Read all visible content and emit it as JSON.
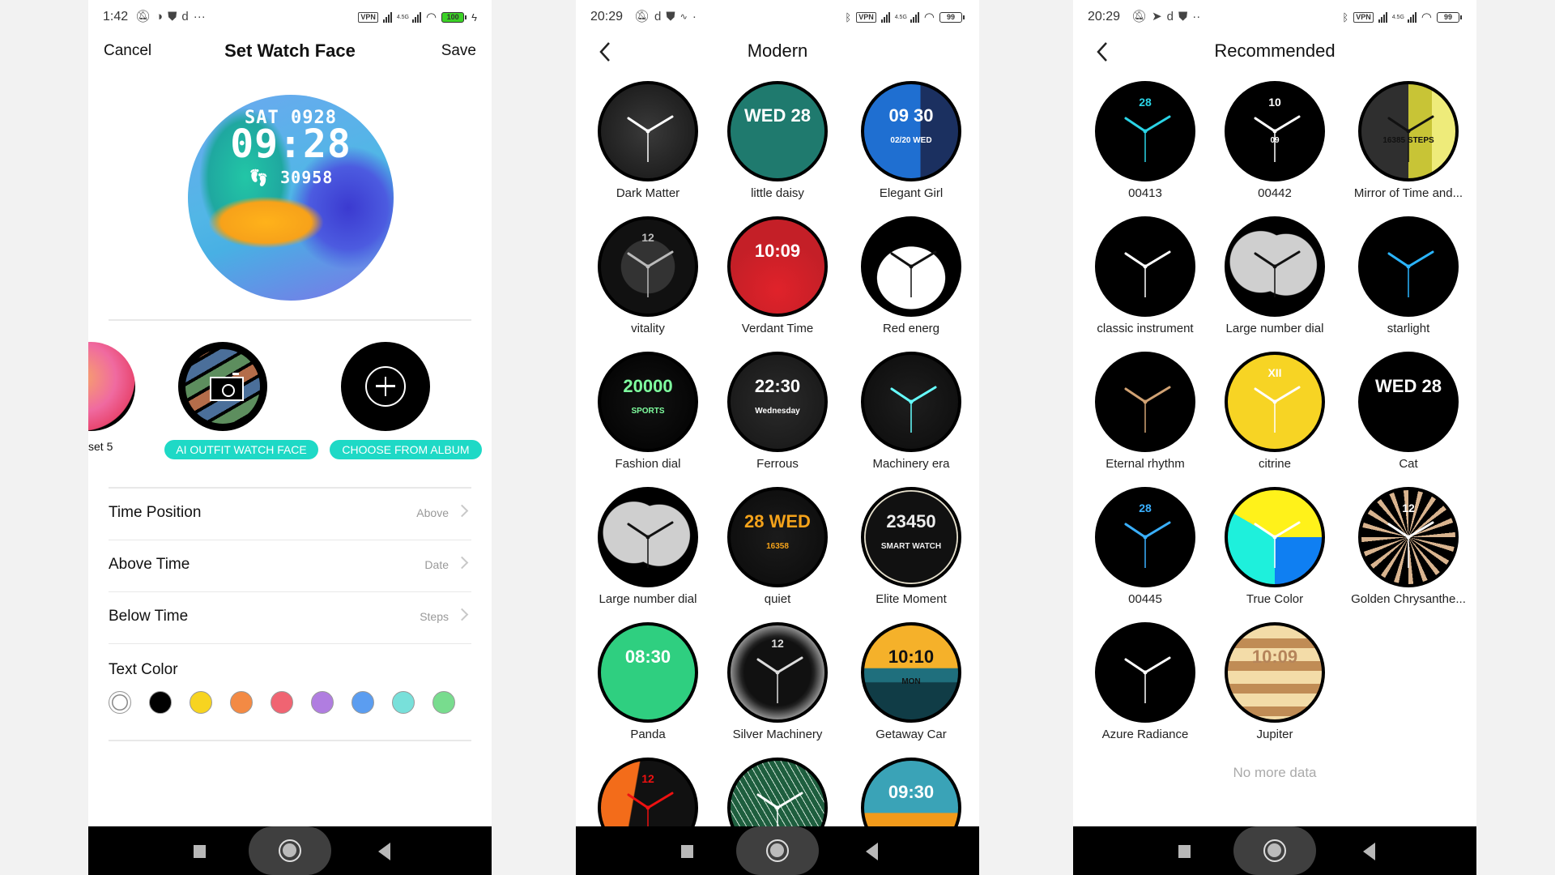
{
  "screens": {
    "set_watch_face": {
      "status": {
        "time": "1:42",
        "battery": "100",
        "network": "4.5G",
        "vpn": "VPN",
        "more": "···"
      },
      "header": {
        "cancel": "Cancel",
        "title": "Set Watch Face",
        "save": "Save"
      },
      "preview": {
        "date": "SAT 0928",
        "time": "09:28",
        "steps": "30958",
        "steps_icon": "footsteps-icon"
      },
      "thumbnails": [
        {
          "label": "set 5"
        },
        {
          "label": "AI OUTFIT WATCH FACE",
          "icon": "camera-icon"
        },
        {
          "label": "CHOOSE FROM ALBUM",
          "icon": "plus-icon"
        }
      ],
      "settings": [
        {
          "label": "Time Position",
          "value": "Above"
        },
        {
          "label": "Above Time",
          "value": "Date"
        },
        {
          "label": "Below Time",
          "value": "Steps"
        }
      ],
      "text_color": {
        "label": "Text Color",
        "selected": "#ffffff",
        "swatches": [
          "#ffffff",
          "#000000",
          "#f7d420",
          "#f38a44",
          "#f06472",
          "#b07de0",
          "#5b9df0",
          "#78e0da",
          "#78dc8e"
        ]
      },
      "accent": "#1ed9c6"
    },
    "modern": {
      "status": {
        "time": "20:29",
        "battery": "99",
        "network": "4.5G",
        "vpn": "VPN",
        "more": "·"
      },
      "header": {
        "title": "Modern"
      },
      "faces": [
        {
          "name": "Dark Matter"
        },
        {
          "name": "little daisy",
          "text": "WED 28"
        },
        {
          "name": "Elegant Girl",
          "text": "09 30",
          "sub": "02/20 WED"
        },
        {
          "name": "vitality",
          "text": "12"
        },
        {
          "name": "Verdant Time",
          "text": "10:09"
        },
        {
          "name": "Red energ"
        },
        {
          "name": "Fashion dial",
          "text": "20000",
          "sub": "SPORTS"
        },
        {
          "name": "Ferrous",
          "text": "22:30",
          "sub": "Wednesday"
        },
        {
          "name": "Machinery era"
        },
        {
          "name": "Large number dial"
        },
        {
          "name": "quiet",
          "text": "28 WED",
          "sub": "16358"
        },
        {
          "name": "Elite Moment",
          "text": "23450",
          "sub": "SMART WATCH"
        },
        {
          "name": "Panda",
          "text": "08:30"
        },
        {
          "name": "Silver Machinery",
          "text": "12"
        },
        {
          "name": "Getaway Car",
          "text": "10:10",
          "sub": "MON"
        },
        {
          "name": "",
          "text": "12"
        },
        {
          "name": ""
        },
        {
          "name": "",
          "text": "09:30"
        }
      ]
    },
    "recommended": {
      "status": {
        "time": "20:29",
        "battery": "99",
        "network": "4.5G",
        "vpn": "VPN",
        "more": "··"
      },
      "header": {
        "title": "Recommended"
      },
      "faces": [
        {
          "name": "00413",
          "text": "28"
        },
        {
          "name": "00442",
          "text": "10",
          "sub": "09"
        },
        {
          "name": "Mirror of Time and...",
          "sub": "16385 STEPS"
        },
        {
          "name": "classic instrument"
        },
        {
          "name": "Large number dial"
        },
        {
          "name": "starlight"
        },
        {
          "name": "Eternal rhythm"
        },
        {
          "name": "citrine",
          "text": "XII"
        },
        {
          "name": "Cat",
          "text": "WED 28"
        },
        {
          "name": "00445",
          "text": "28"
        },
        {
          "name": "True Color"
        },
        {
          "name": "Golden Chrysanthe...",
          "text": "12"
        },
        {
          "name": "Azure Radiance"
        },
        {
          "name": "Jupiter",
          "text": "10:09"
        }
      ],
      "footer": "No more data"
    }
  }
}
